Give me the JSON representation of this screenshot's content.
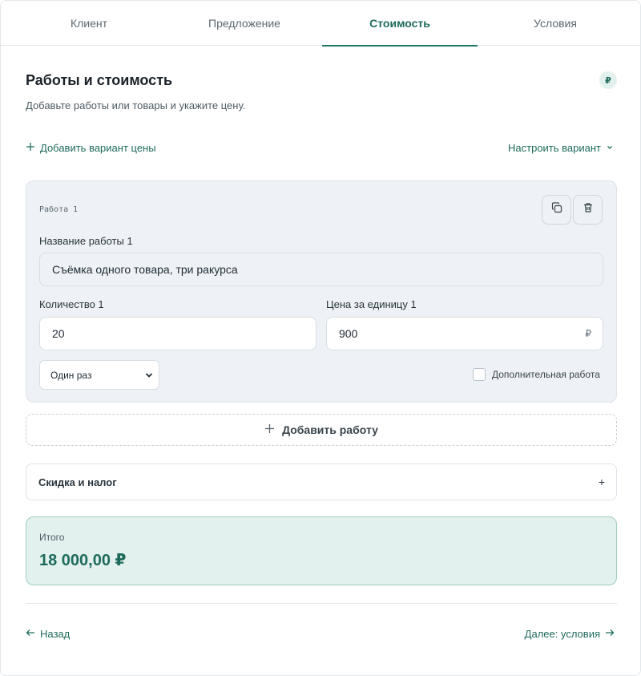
{
  "tabs": [
    {
      "label": "Клиент",
      "active": false
    },
    {
      "label": "Предложение",
      "active": false
    },
    {
      "label": "Стоимость",
      "active": true
    },
    {
      "label": "Условия",
      "active": false
    }
  ],
  "section": {
    "title": "Работы и стоимость",
    "subtitle": "Добавьте работы или товары и укажите цену.",
    "currency_symbol": "₽"
  },
  "actions": {
    "add_variant_label": "Добавить вариант цены",
    "configure_label": "Настроить вариант"
  },
  "work_item": {
    "number_label": "Работа 1",
    "name_label": "Название работы 1",
    "name_value": "Съёмка одного товара, три ракурса",
    "quantity_label": "Количество 1",
    "quantity_value": "20",
    "price_label": "Цена за единицу 1",
    "price_value": "900",
    "price_suffix": "₽",
    "frequency_value": "Один раз",
    "extra_work_label": "Дополнительная работа",
    "extra_work_checked": false
  },
  "add_work_label": "Добавить работу",
  "discount_label": "Скидка и налог",
  "discount_toggle": "+",
  "total": {
    "label": "Итого",
    "value": "18 000,00 ₽"
  },
  "nav": {
    "back_label": "Назад",
    "next_label": "Далее: условия"
  },
  "colors": {
    "accent": "#1e6b5c",
    "accent_light": "#e3f1ee",
    "work_bg": "#eef2f6"
  }
}
